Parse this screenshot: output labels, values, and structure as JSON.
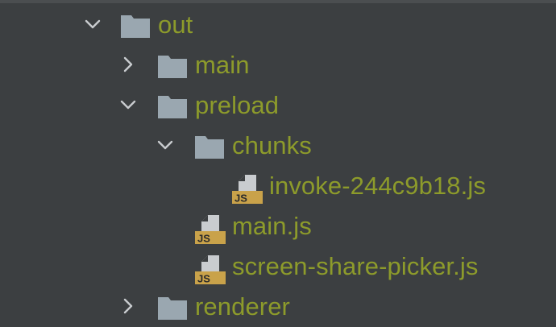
{
  "tree": {
    "rows": [
      {
        "label": "out",
        "kind": "folder",
        "expanded": true
      },
      {
        "label": "main",
        "kind": "folder",
        "expanded": false
      },
      {
        "label": "preload",
        "kind": "folder",
        "expanded": true
      },
      {
        "label": "chunks",
        "kind": "folder",
        "expanded": true
      },
      {
        "label": "invoke-244c9b18.js",
        "kind": "js-file"
      },
      {
        "label": "main.js",
        "kind": "js-file"
      },
      {
        "label": "screen-share-picker.js",
        "kind": "js-file"
      },
      {
        "label": "renderer",
        "kind": "folder",
        "expanded": false
      }
    ],
    "file_badge_text": "JS"
  },
  "colors": {
    "background": "#3c3f41",
    "label": "#8d9b2b",
    "folder_icon": "#9aa7b0",
    "chevron": "#c9cccf",
    "js_badge": "#c9a24a"
  }
}
